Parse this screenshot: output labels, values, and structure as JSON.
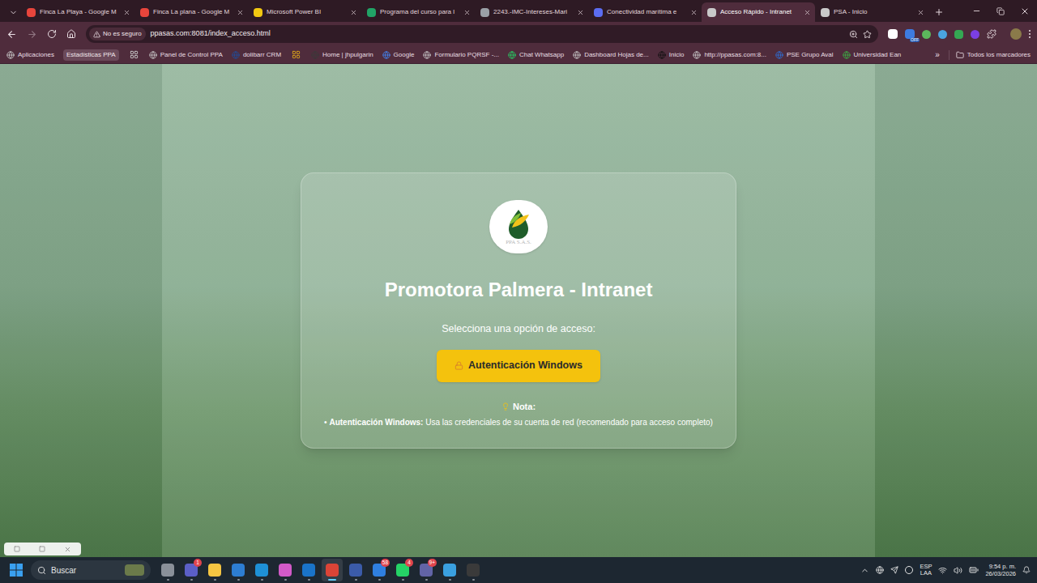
{
  "browser": {
    "tabs": [
      {
        "label": "Finca La Playa - Google M",
        "selected": false,
        "color": "#e8453c"
      },
      {
        "label": "Finca La plana - Google M",
        "selected": false,
        "color": "#e8453c"
      },
      {
        "label": "Microsoft Power BI",
        "selected": false,
        "color": "#f2c811"
      },
      {
        "label": "Programa del curso para l",
        "selected": false,
        "color": "#21a366"
      },
      {
        "label": "2243.-IMC-Intereses-Mari",
        "selected": false,
        "color": "#9aa0a6"
      },
      {
        "label": "Conectividad marítima e",
        "selected": false,
        "color": "#5b6cf0"
      },
      {
        "label": "Acceso Rápido - Intranet",
        "selected": true,
        "color": "#c9c9c9"
      },
      {
        "label": "PSA - Inicio",
        "selected": false,
        "color": "#c9c9c9"
      }
    ],
    "address": {
      "security": "No es seguro",
      "url": "ppasas.com:8081/index_acceso.html"
    },
    "extension_badge": "OFF",
    "bookmarks": [
      {
        "kind": "link",
        "label": "Aplicaciones",
        "color": "#c9c9c9"
      },
      {
        "kind": "text",
        "label": "Estadísticas PPA",
        "color": "#6b4a5a"
      },
      {
        "kind": "icon",
        "label": "",
        "color": "#c9c9c9"
      },
      {
        "kind": "link",
        "label": "Panel de Control PPA",
        "color": "#c9c9c9"
      },
      {
        "kind": "link",
        "label": "dolibarr CRM",
        "color": "#1f4e9c"
      },
      {
        "kind": "icon",
        "label": "",
        "color": "#d9a21b"
      },
      {
        "kind": "link",
        "label": "Home | jhpulgarin",
        "color": "#3a3a3a"
      },
      {
        "kind": "link",
        "label": "Google",
        "color": "#4285f4"
      },
      {
        "kind": "link",
        "label": "Formulario PQRSF -...",
        "color": "#c9c9c9"
      },
      {
        "kind": "link",
        "label": "Chat Whatsapp",
        "color": "#25d366"
      },
      {
        "kind": "link",
        "label": "Dashboard Hojas de...",
        "color": "#c9c9c9"
      },
      {
        "kind": "link",
        "label": "Inicio",
        "color": "#111111"
      },
      {
        "kind": "link",
        "label": "http://ppasas.com:8...",
        "color": "#c9c9c9"
      },
      {
        "kind": "link",
        "label": "PSE Grupo Aval",
        "color": "#2f6fd6"
      },
      {
        "kind": "link",
        "label": "Universidad Ean",
        "color": "#3cb043"
      }
    ],
    "bookmarks_overflow": "»",
    "all_bookmarks": "Todos los marcadores"
  },
  "page": {
    "logo_text": "PPA S.A.S.",
    "title": "Promotora Palmera - Intranet",
    "prompt": "Selecciona una opción de acceso:",
    "button": "Autenticación Windows",
    "note": {
      "heading": "Nota:",
      "bullet": "•",
      "term": "Autenticación Windows:",
      "text": "Usa las credenciales de su cuenta de red (recomendado para acceso completo)"
    }
  },
  "taskbar": {
    "search": "Buscar",
    "apps": [
      {
        "color": "#8a9099",
        "selected": false
      },
      {
        "color": "#5b5fc7",
        "selected": false,
        "badge": "1"
      },
      {
        "color": "#f5c542",
        "selected": false
      },
      {
        "color": "#2d7dd2",
        "selected": false
      },
      {
        "color": "#1e90d6",
        "selected": false
      },
      {
        "color": "#d25ac8",
        "selected": false
      },
      {
        "color": "#1a73c8",
        "selected": false
      },
      {
        "color": "#db4437",
        "selected": true
      },
      {
        "color": "#3b5ba9",
        "selected": false
      },
      {
        "color": "#2f7fe0",
        "selected": false,
        "badge": "58"
      },
      {
        "color": "#25d366",
        "selected": false,
        "badge": "4"
      },
      {
        "color": "#6264a7",
        "selected": false,
        "badge": "9+"
      },
      {
        "color": "#3aa0e0",
        "selected": false
      },
      {
        "color": "#3a3a3a",
        "selected": false
      }
    ],
    "tray": {
      "language": "ESP",
      "layout": "LAA",
      "time": "9:54 p. m.",
      "date": "26/03/2026"
    }
  }
}
